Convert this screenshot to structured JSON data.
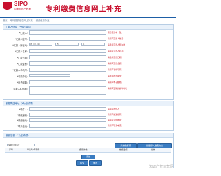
{
  "header": {
    "logo_text": "SIPO",
    "logo_subtitle": "国家知识产权局",
    "title": "专利缴费信息网上补充",
    "breadcrumb": [
      "首页",
      "专利缴费信息网上补充",
      "缴费信息补充"
    ]
  },
  "payer_section": {
    "title": "汇款人信息（*为必填项）",
    "fields": [
      {
        "label": "*汇款人:",
        "hint": "须与汇款单一致"
      },
      {
        "label": "*汇款人账号:",
        "hint": "请填写汇款人账号"
      },
      {
        "label": "*汇款人所在地:",
        "hint": "请选择汇款人所在地"
      },
      {
        "label": "*汇款人名称:",
        "hint": "请填写汇款人名称"
      },
      {
        "label": "*汇款日期:",
        "hint": "请选择汇款日期"
      },
      {
        "label": "*汇款金额:",
        "hint": "请填写汇款金额"
      },
      {
        "label": "*汇款人手机号:",
        "hint": "请填写手机号码"
      },
      {
        "label": "*收款单位:",
        "hint": "请选择收款单位"
      },
      {
        "label": "*电子邮箱:",
        "hint": "请填写电子邮箱"
      },
      {
        "label": "汇款人E-mail:",
        "hint": "请填写正确的邮件地址"
      }
    ],
    "selects": [
      {
        "label": "省（市、区）"
      },
      {
        "label": "市"
      },
      {
        "label": "区"
      }
    ]
  },
  "receipt_section": {
    "title": "收据寄送地址（*为必填项）",
    "fields": [
      {
        "label": "*收件人:",
        "hint": "请填写收件人"
      },
      {
        "label": "*邮政编码:",
        "hint": "请填写邮政编码"
      },
      {
        "label": "*详细地址:",
        "hint": "请填写详细地址"
      },
      {
        "label": "*联系电话:",
        "hint": "请填写联系电话"
      }
    ]
  },
  "fee_section": {
    "title": "缴费信息（*为必填项）",
    "type_label": "专利号/申请号",
    "add_button": "添加缴费项",
    "import_button": "批量导入缴费信息",
    "columns": [
      "序号",
      "申请号/专利号",
      "费用种类",
      "缴费金额",
      "操作"
    ],
    "add_row_button": "添加",
    "submit_button": "提交",
    "reset_button": "重置"
  },
  "watermark": "知识产权运营网"
}
